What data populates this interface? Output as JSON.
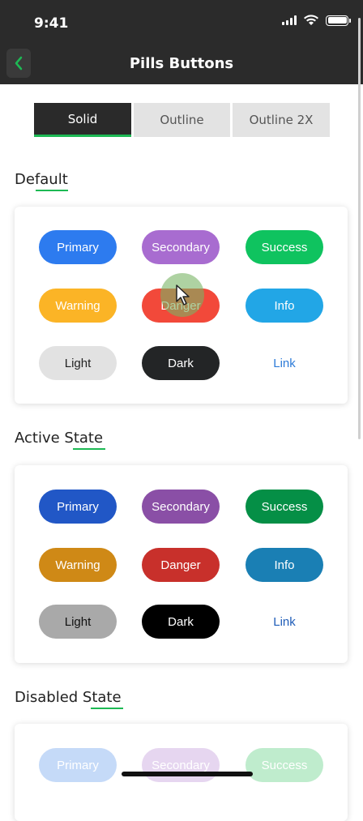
{
  "status": {
    "time": "9:41"
  },
  "nav": {
    "title": "Pills Buttons"
  },
  "tabs": [
    {
      "label": "Solid",
      "active": true
    },
    {
      "label": "Outline",
      "active": false
    },
    {
      "label": "Outline 2X",
      "active": false
    }
  ],
  "sections": [
    {
      "title": "Default",
      "buttons": [
        {
          "label": "Primary",
          "bg": "#2d7bef",
          "fg": "#ffffff"
        },
        {
          "label": "Secondary",
          "bg": "#a86cd0",
          "fg": "#ffffff"
        },
        {
          "label": "Success",
          "bg": "#0fc35f",
          "fg": "#ffffff"
        },
        {
          "label": "Warning",
          "bg": "#fbb426",
          "fg": "#ffffff"
        },
        {
          "label": "Danger",
          "bg": "#f2493a",
          "fg": "#ffffff"
        },
        {
          "label": "Info",
          "bg": "#22a6e6",
          "fg": "#ffffff"
        },
        {
          "label": "Light",
          "bg": "#e2e2e2",
          "fg": "#222222"
        },
        {
          "label": "Dark",
          "bg": "#232526",
          "fg": "#ffffff"
        },
        {
          "label": "Link",
          "bg": "transparent",
          "fg": "#2d7bd8"
        }
      ]
    },
    {
      "title": "Active State",
      "buttons": [
        {
          "label": "Primary",
          "bg": "#2157c6",
          "fg": "#ffffff"
        },
        {
          "label": "Secondary",
          "bg": "#8a4fa6",
          "fg": "#ffffff"
        },
        {
          "label": "Success",
          "bg": "#058f46",
          "fg": "#ffffff"
        },
        {
          "label": "Warning",
          "bg": "#cf8916",
          "fg": "#ffffff"
        },
        {
          "label": "Danger",
          "bg": "#c8302b",
          "fg": "#ffffff"
        },
        {
          "label": "Info",
          "bg": "#1a7fb4",
          "fg": "#ffffff"
        },
        {
          "label": "Light",
          "bg": "#a9a9a9",
          "fg": "#111111"
        },
        {
          "label": "Dark",
          "bg": "#000000",
          "fg": "#ffffff"
        },
        {
          "label": "Link",
          "bg": "transparent",
          "fg": "#1f5db8"
        }
      ]
    },
    {
      "title": "Disabled State",
      "buttons": [
        {
          "label": "Primary",
          "bg": "#c5daf8",
          "fg": "#ffffff"
        },
        {
          "label": "Secondary",
          "bg": "#e6d6f0",
          "fg": "#ffffff"
        },
        {
          "label": "Success",
          "bg": "#bfeccd",
          "fg": "#ffffff"
        }
      ]
    }
  ]
}
